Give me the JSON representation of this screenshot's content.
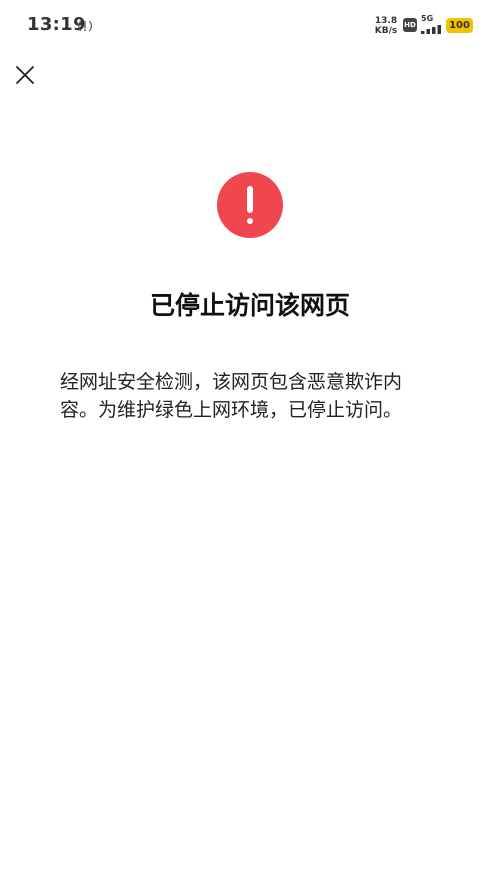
{
  "status_bar": {
    "time": "13:19",
    "net_speed_value": "13.8",
    "net_speed_unit": "KB/s",
    "hd_badge": "HD",
    "network_type": "5G",
    "battery_level": "100",
    "battery_color": "#f2c200"
  },
  "icons": {
    "close": "close-icon",
    "warning": "exclamation-icon",
    "hotspot": "hotspot-icon",
    "signal": "signal-icon",
    "battery": "battery-icon"
  },
  "colors": {
    "warning": "#f0474f"
  },
  "main": {
    "title": "已停止访问该网页",
    "description_lines": [
      "经网址安全检测，该网页包含恶意欺诈内",
      "容。为维护绿色上网环境，已停止访问。"
    ]
  }
}
